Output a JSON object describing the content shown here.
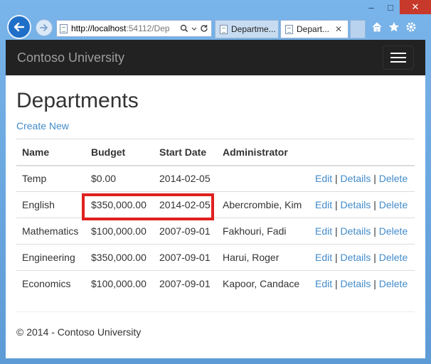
{
  "browser": {
    "address": {
      "host": "http://localhost",
      "rest": ":54112/Dep",
      "search_icon": "search-icon",
      "dropdown_icon": "chevron-down-icon",
      "refresh_icon": "refresh-icon"
    },
    "tabs": [
      {
        "label": "Departme..."
      },
      {
        "label": "Depart...",
        "close": "✕"
      }
    ],
    "window_controls": {
      "minimize": "–",
      "maximize": "□",
      "close": "✕"
    }
  },
  "navbar": {
    "brand": "Contoso University"
  },
  "page": {
    "title": "Departments",
    "create_link": "Create New",
    "columns": [
      "Name",
      "Budget",
      "Start Date",
      "Administrator"
    ],
    "rows": [
      {
        "name": "Temp",
        "budget": "$0.00",
        "start": "2014-02-05",
        "admin": ""
      },
      {
        "name": "English",
        "budget": "$350,000.00",
        "start": "2014-02-05",
        "admin": "Abercrombie, Kim"
      },
      {
        "name": "Mathematics",
        "budget": "$100,000.00",
        "start": "2007-09-01",
        "admin": "Fakhouri, Fadi"
      },
      {
        "name": "Engineering",
        "budget": "$350,000.00",
        "start": "2007-09-01",
        "admin": "Harui, Roger"
      },
      {
        "name": "Economics",
        "budget": "$100,000.00",
        "start": "2007-09-01",
        "admin": "Kapoor, Candace"
      }
    ],
    "actions": {
      "edit": "Edit",
      "details": "Details",
      "delete": "Delete",
      "separator": "|"
    },
    "footer": "© 2014 - Contoso University"
  },
  "colors": {
    "link": "#428bca",
    "navbar_bg": "#222222",
    "highlight": "#e02020"
  }
}
